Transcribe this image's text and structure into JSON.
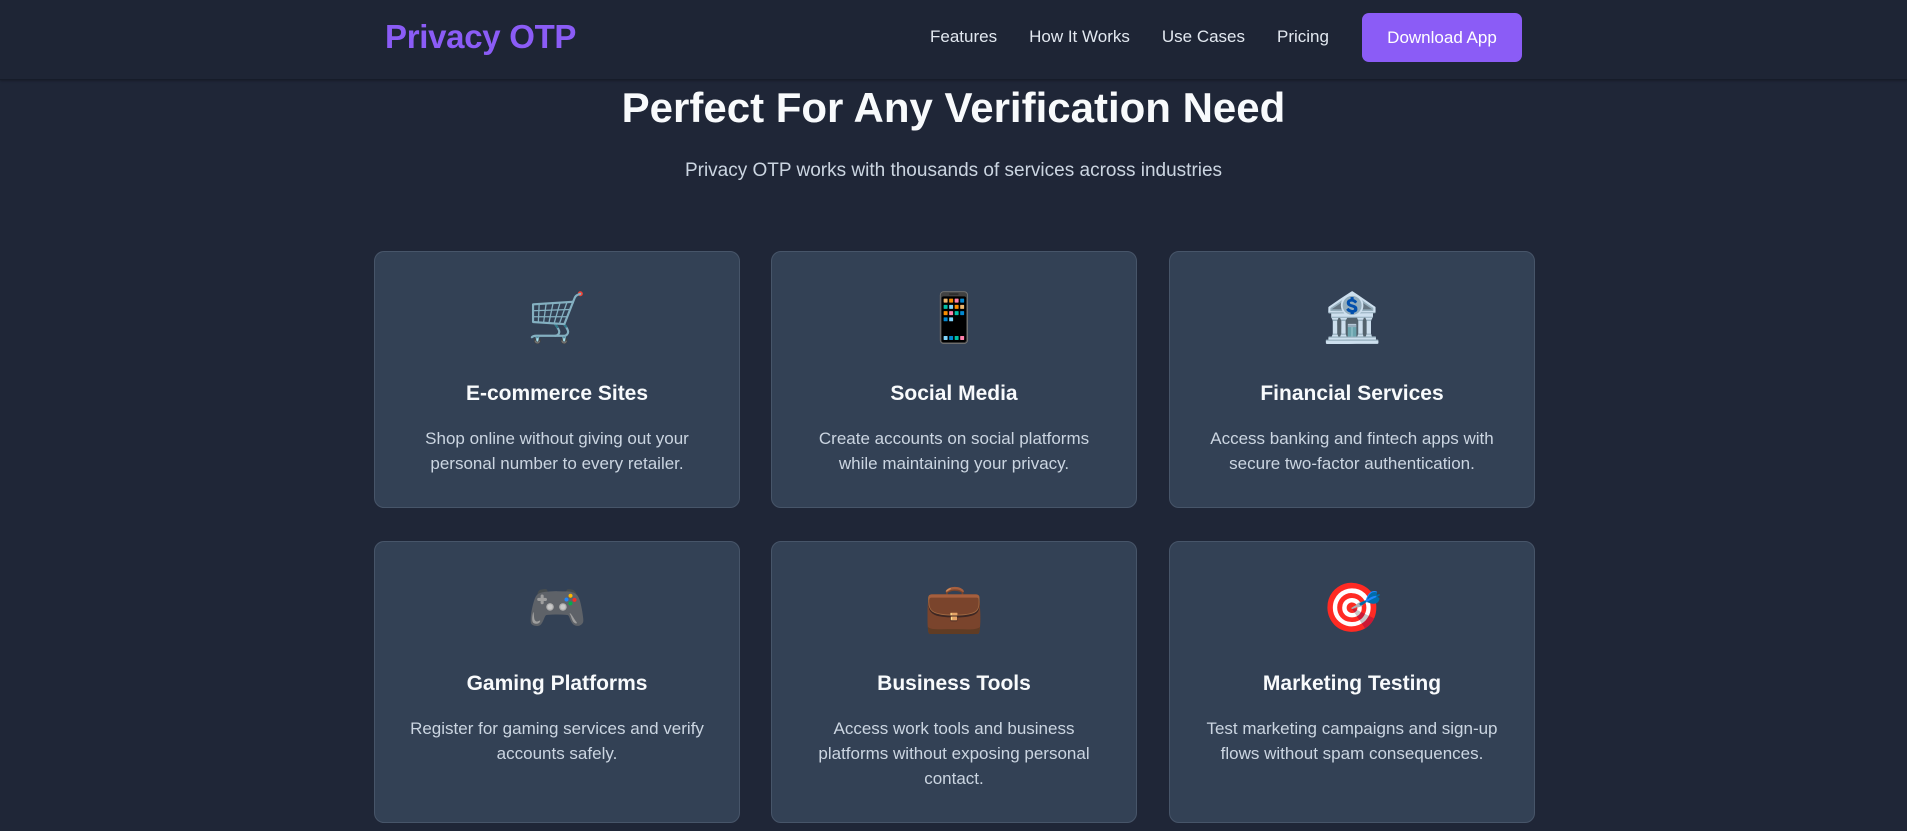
{
  "nav": {
    "brand": "Privacy OTP",
    "links": [
      "Features",
      "How It Works",
      "Use Cases",
      "Pricing"
    ],
    "cta": "Download App"
  },
  "section": {
    "title": "Perfect For Any Verification Need",
    "subtitle": "Privacy OTP works with thousands of services across industries"
  },
  "cards": [
    {
      "icon": "🛒",
      "icon_name": "shopping-cart-icon",
      "title": "E-commerce Sites",
      "desc": "Shop online without giving out your personal number to every retailer."
    },
    {
      "icon": "📱",
      "icon_name": "mobile-phone-icon",
      "title": "Social Media",
      "desc": "Create accounts on social platforms while maintaining your privacy."
    },
    {
      "icon": "🏦",
      "icon_name": "bank-icon",
      "title": "Financial Services",
      "desc": "Access banking and fintech apps with secure two-factor authentication."
    },
    {
      "icon": "🎮",
      "icon_name": "game-controller-icon",
      "title": "Gaming Platforms",
      "desc": "Register for gaming services and verify accounts safely."
    },
    {
      "icon": "💼",
      "icon_name": "briefcase-icon",
      "title": "Business Tools",
      "desc": "Access work tools and business platforms without exposing personal contact."
    },
    {
      "icon": "🎯",
      "icon_name": "target-icon",
      "title": "Marketing Testing",
      "desc": "Test marketing campaigns and sign-up flows without spam consequences."
    }
  ],
  "colors": {
    "accent": "#8b5cf6",
    "background": "#1f2637",
    "card": "#334155"
  }
}
